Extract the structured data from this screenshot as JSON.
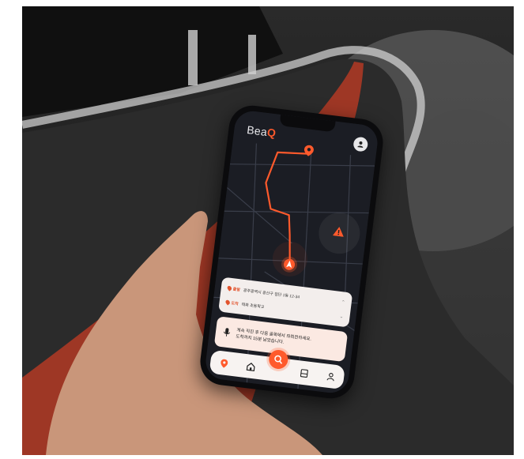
{
  "app": {
    "logo_text": "Bea",
    "logo_accent": "Q"
  },
  "route": {
    "origin_label": "출발",
    "origin_address": "광주광역시 광산구 첨단 1동 12-34",
    "destination_label": "도착",
    "destination_name": "태화 초등학교"
  },
  "voice": {
    "line1": "계속 직진 후 다음 골목에서 좌회전하세요.",
    "line2": "도착까지 15분 남았습니다."
  },
  "icons": {
    "profile": "user-icon",
    "alert": "warning-icon",
    "destination": "map-pin-icon",
    "current": "navigation-arrow-icon",
    "mic": "mic-icon",
    "tabs": [
      "map-pin-icon",
      "home-icon",
      "search-logo-icon",
      "book-icon",
      "person-icon"
    ]
  },
  "colors": {
    "accent": "#ff5a2c",
    "map_bg": "#1b1d24",
    "card_bg": "#f3eeec",
    "voice_bg": "#fbe9e2"
  }
}
